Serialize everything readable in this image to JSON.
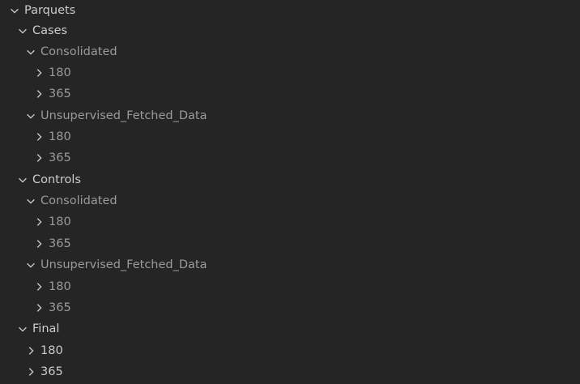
{
  "tree": {
    "root": {
      "label": "Parquets",
      "expanded": true
    },
    "cases": {
      "label": "Cases",
      "consolidated": {
        "label": "Consolidated",
        "items": [
          "180",
          "365"
        ]
      },
      "unsupervised": {
        "label": "Unsupervised_Fetched_Data",
        "items": [
          "180",
          "365"
        ]
      }
    },
    "controls": {
      "label": "Controls",
      "consolidated": {
        "label": "Consolidated",
        "items": [
          "180",
          "365"
        ]
      },
      "unsupervised": {
        "label": "Unsupervised_Fetched_Data",
        "items": [
          "180",
          "365"
        ]
      }
    },
    "final": {
      "label": "Final",
      "items": [
        "180",
        "365"
      ]
    }
  },
  "icons": {
    "expanded": "chevron-down-icon",
    "collapsed": "chevron-right-icon"
  },
  "colors": {
    "background": "#252526",
    "text": "#cccccc",
    "text_dim": "#9a9a9a"
  }
}
